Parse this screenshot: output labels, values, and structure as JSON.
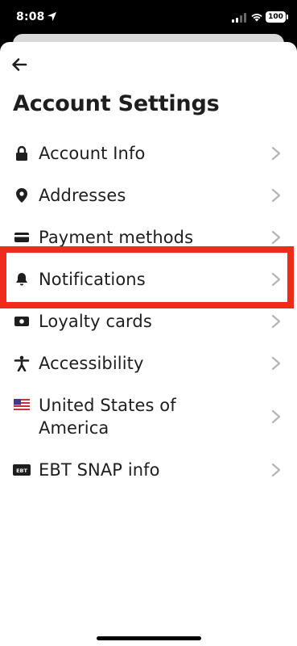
{
  "status_bar": {
    "time": "8:08",
    "battery": "100"
  },
  "page": {
    "title": "Account Settings"
  },
  "menu": {
    "items": [
      {
        "label": "Account Info",
        "icon": "lock-icon"
      },
      {
        "label": "Addresses",
        "icon": "location-pin-icon"
      },
      {
        "label": "Payment methods",
        "icon": "credit-card-icon"
      },
      {
        "label": "Notifications",
        "icon": "bell-icon"
      },
      {
        "label": "Loyalty cards",
        "icon": "loyalty-card-icon"
      },
      {
        "label": "Accessibility",
        "icon": "accessibility-icon"
      },
      {
        "label_line1": "United States of",
        "label_line2": "America",
        "icon": "us-flag-icon"
      },
      {
        "label": "EBT SNAP info",
        "icon": "ebt-card-icon"
      }
    ]
  },
  "colors": {
    "text": "#1e1e1e",
    "chevron": "#b5b5b5",
    "highlight": "#ee2b1c"
  }
}
